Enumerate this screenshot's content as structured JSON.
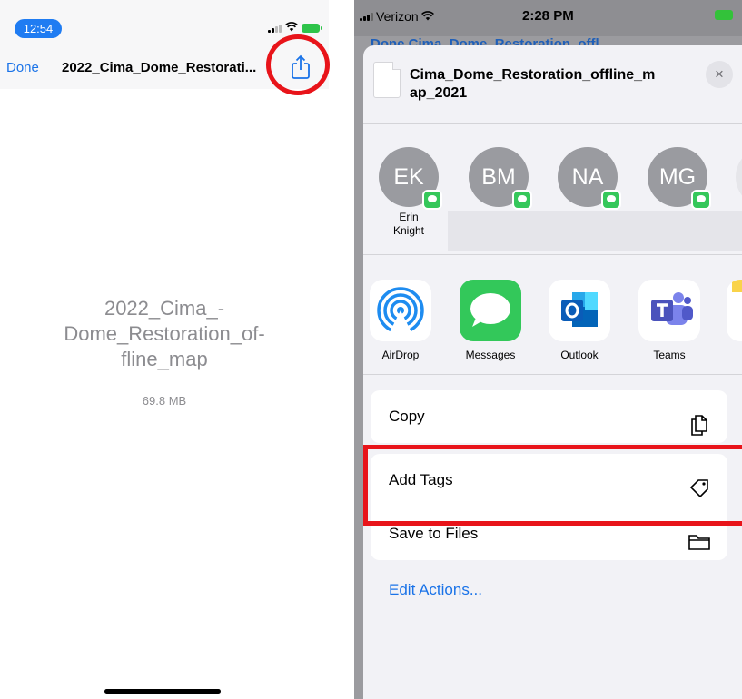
{
  "left": {
    "status": {
      "time": "12:54"
    },
    "nav": {
      "done": "Done",
      "title": "2022_Cima_Dome_Restorati..."
    },
    "file": {
      "name_lines": [
        "2022_Cima_-",
        "Dome_Restoration_of-",
        "fline_map"
      ],
      "size": "69.8 MB"
    }
  },
  "right": {
    "status": {
      "carrier": "Verizon",
      "time": "2:28 PM"
    },
    "behind_title": "Done  Cima_Dome_Restoration_offl",
    "sheet": {
      "title_lines": [
        "Cima_Dome_Restoration_offline_m",
        "ap_2021"
      ],
      "close": "×"
    },
    "contacts": [
      {
        "initials": "EK",
        "name_lines": [
          "Erin",
          "Knight"
        ]
      },
      {
        "initials": "BM",
        "name_lines": []
      },
      {
        "initials": "NA",
        "name_lines": []
      },
      {
        "initials": "MG",
        "name_lines": []
      }
    ],
    "apps": [
      {
        "label": "AirDrop",
        "icon": "airdrop-icon"
      },
      {
        "label": "Messages",
        "icon": "messages-icon"
      },
      {
        "label": "Outlook",
        "icon": "outlook-icon"
      },
      {
        "label": "Teams",
        "icon": "teams-icon"
      }
    ],
    "actions_group1": [
      {
        "label": "Copy",
        "icon": "copy-icon"
      }
    ],
    "actions_group2": [
      {
        "label": "Add Tags",
        "icon": "tag-icon"
      },
      {
        "label": "Save to Files",
        "icon": "folder-icon"
      }
    ],
    "edit_actions": "Edit Actions..."
  },
  "colors": {
    "accent_blue": "#1a73e8",
    "highlight_red": "#e8141a",
    "message_green": "#35c75a"
  }
}
